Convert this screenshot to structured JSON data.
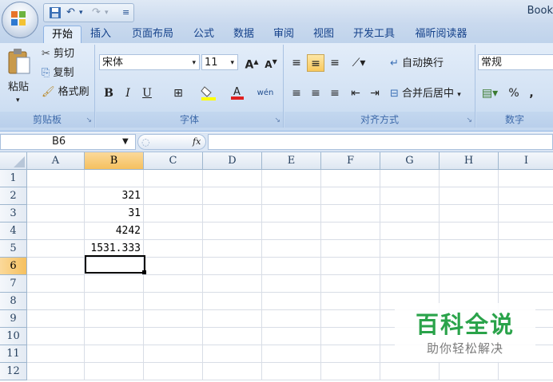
{
  "window": {
    "title": "Book"
  },
  "quick_access": {
    "items": [
      "save-icon",
      "undo-icon",
      "redo-icon",
      "customize-icon"
    ]
  },
  "tabs": [
    {
      "label": "开始",
      "active": true
    },
    {
      "label": "插入"
    },
    {
      "label": "页面布局"
    },
    {
      "label": "公式"
    },
    {
      "label": "数据"
    },
    {
      "label": "审阅"
    },
    {
      "label": "视图"
    },
    {
      "label": "开发工具"
    },
    {
      "label": "福昕阅读器"
    }
  ],
  "clipboard": {
    "paste": "粘贴",
    "cut": "剪切",
    "copy": "复制",
    "format_painter": "格式刷",
    "group_label": "剪贴板"
  },
  "font": {
    "name": "宋体",
    "size": "11",
    "grow": "A",
    "shrink": "A",
    "bold": "B",
    "italic": "I",
    "underline": "U",
    "phonetic": "wén",
    "group_label": "字体"
  },
  "alignment": {
    "wrap_text": "自动换行",
    "merge_center": "合并后居中",
    "group_label": "对齐方式"
  },
  "number": {
    "format": "常规",
    "percent": "%",
    "comma": ",",
    "group_label": "数字"
  },
  "formula_bar": {
    "name_box": "B6",
    "fx": "fx",
    "formula": ""
  },
  "sheet": {
    "columns": [
      "A",
      "B",
      "C",
      "D",
      "E",
      "F",
      "G",
      "H",
      "I"
    ],
    "rows": [
      "1",
      "2",
      "3",
      "4",
      "5",
      "6",
      "7",
      "8",
      "9",
      "10",
      "11",
      "12"
    ],
    "active_col": "B",
    "active_row": "6",
    "cells": {
      "B2": "321",
      "B3": "31",
      "B4": "4242",
      "B5": "1531.333"
    }
  },
  "watermark": {
    "title": "百科全说",
    "subtitle": "助你轻松解决"
  },
  "colors": {
    "accent": "#15428b",
    "selection": "#f9c95d",
    "watermark_green": "#2aa34a"
  }
}
